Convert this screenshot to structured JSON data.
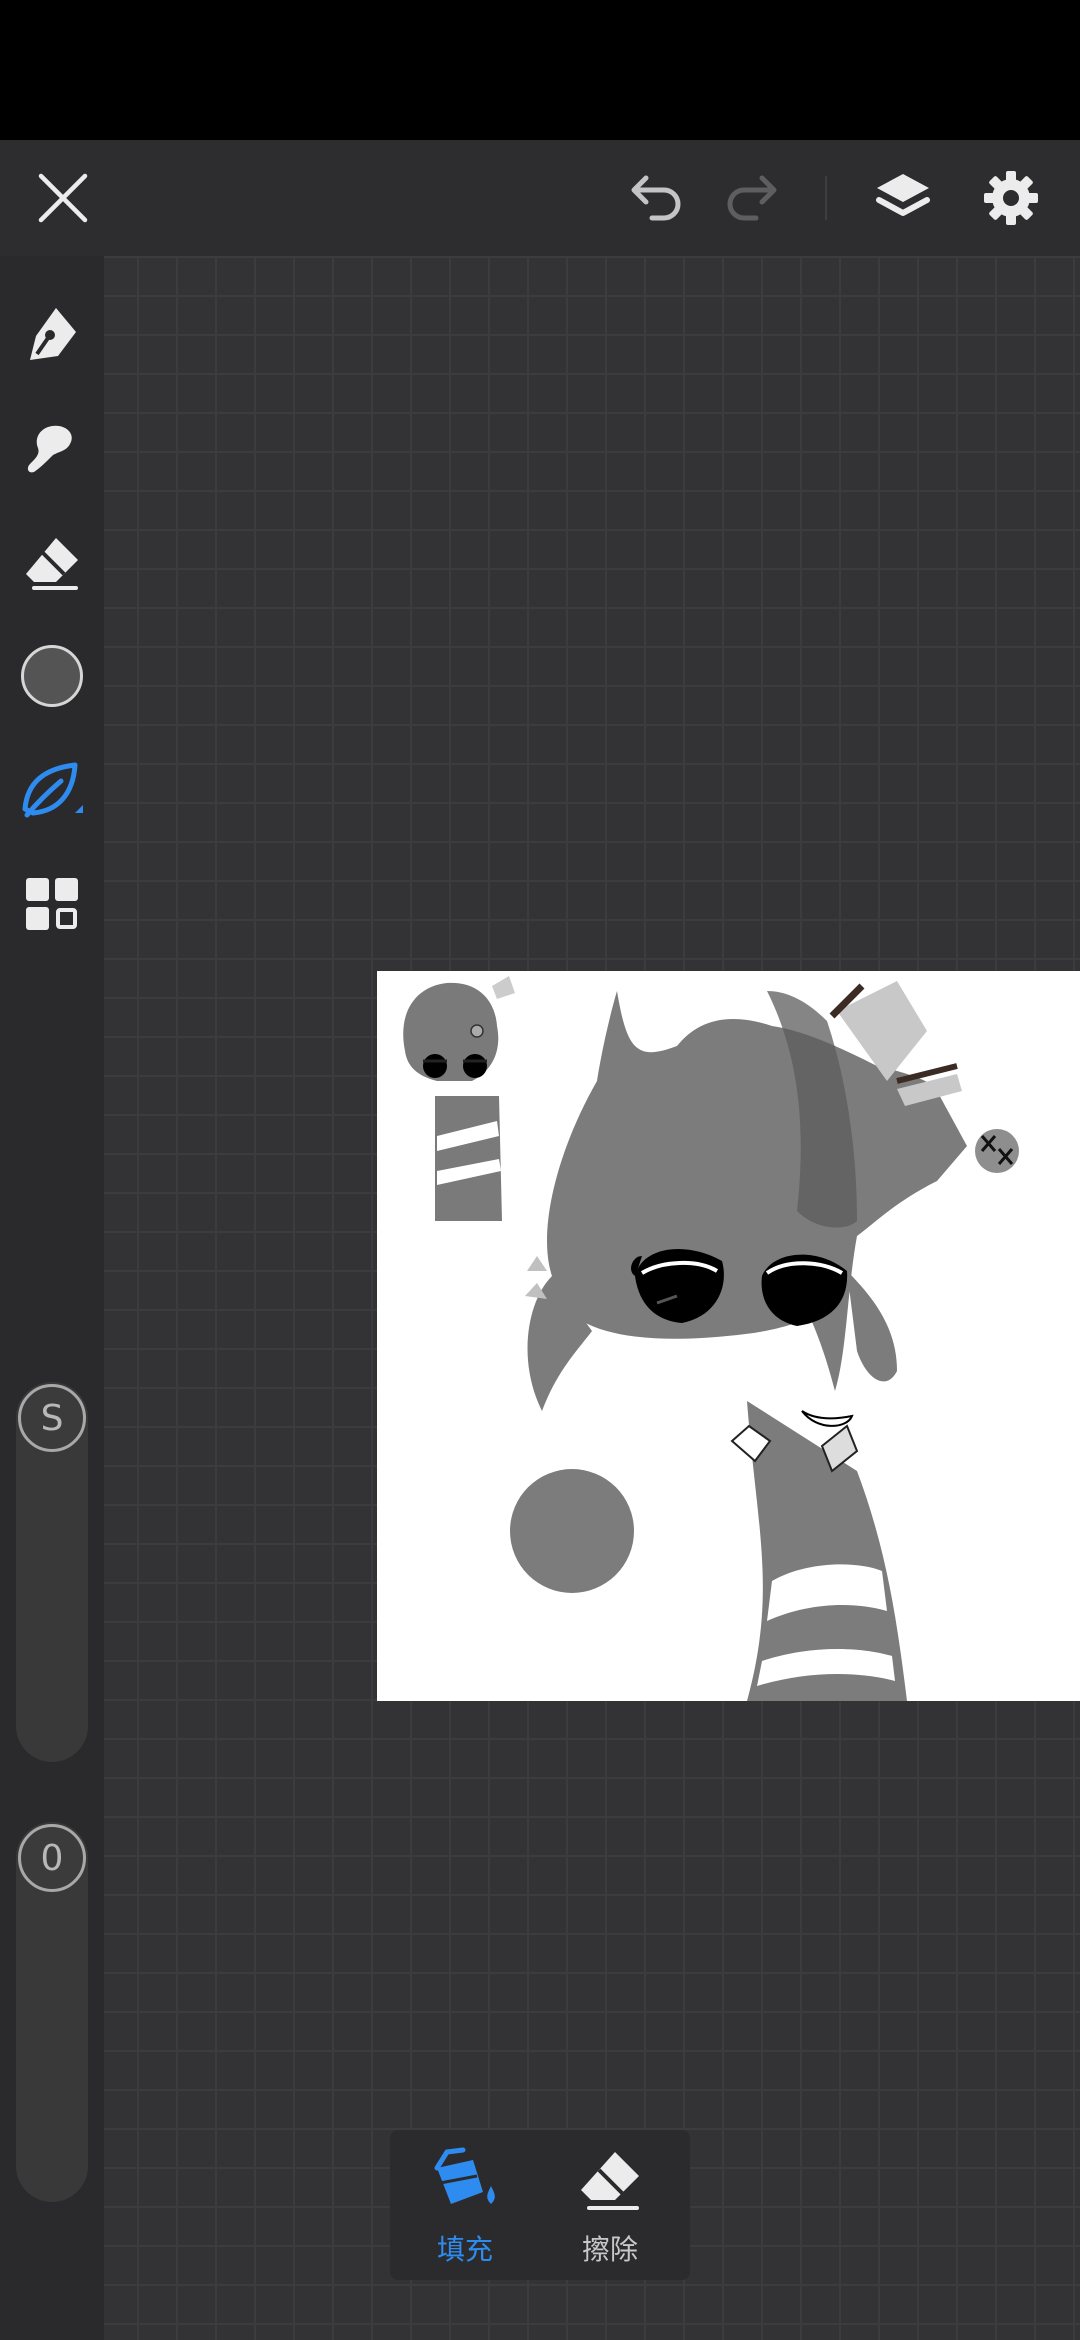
{
  "toolbar": {
    "close": "close",
    "undo": "undo",
    "redo": "redo",
    "layers": "layers",
    "settings": "settings"
  },
  "sidebar": {
    "tools": [
      "pen-tool",
      "smudge-tool",
      "eraser-tool",
      "color-swatch",
      "fill-tool",
      "grid-menu"
    ],
    "active_tool": "fill-tool",
    "current_color": "#545454",
    "size_slider": {
      "label": "S"
    },
    "opacity_slider": {
      "label": "0"
    }
  },
  "fill_popup": {
    "fill_label": "填充",
    "erase_label": "擦除",
    "selected": "fill"
  },
  "colors": {
    "accent": "#2e8cf0",
    "toolbar_bg": "#2d2d2f",
    "workspace_bg": "#333335"
  }
}
